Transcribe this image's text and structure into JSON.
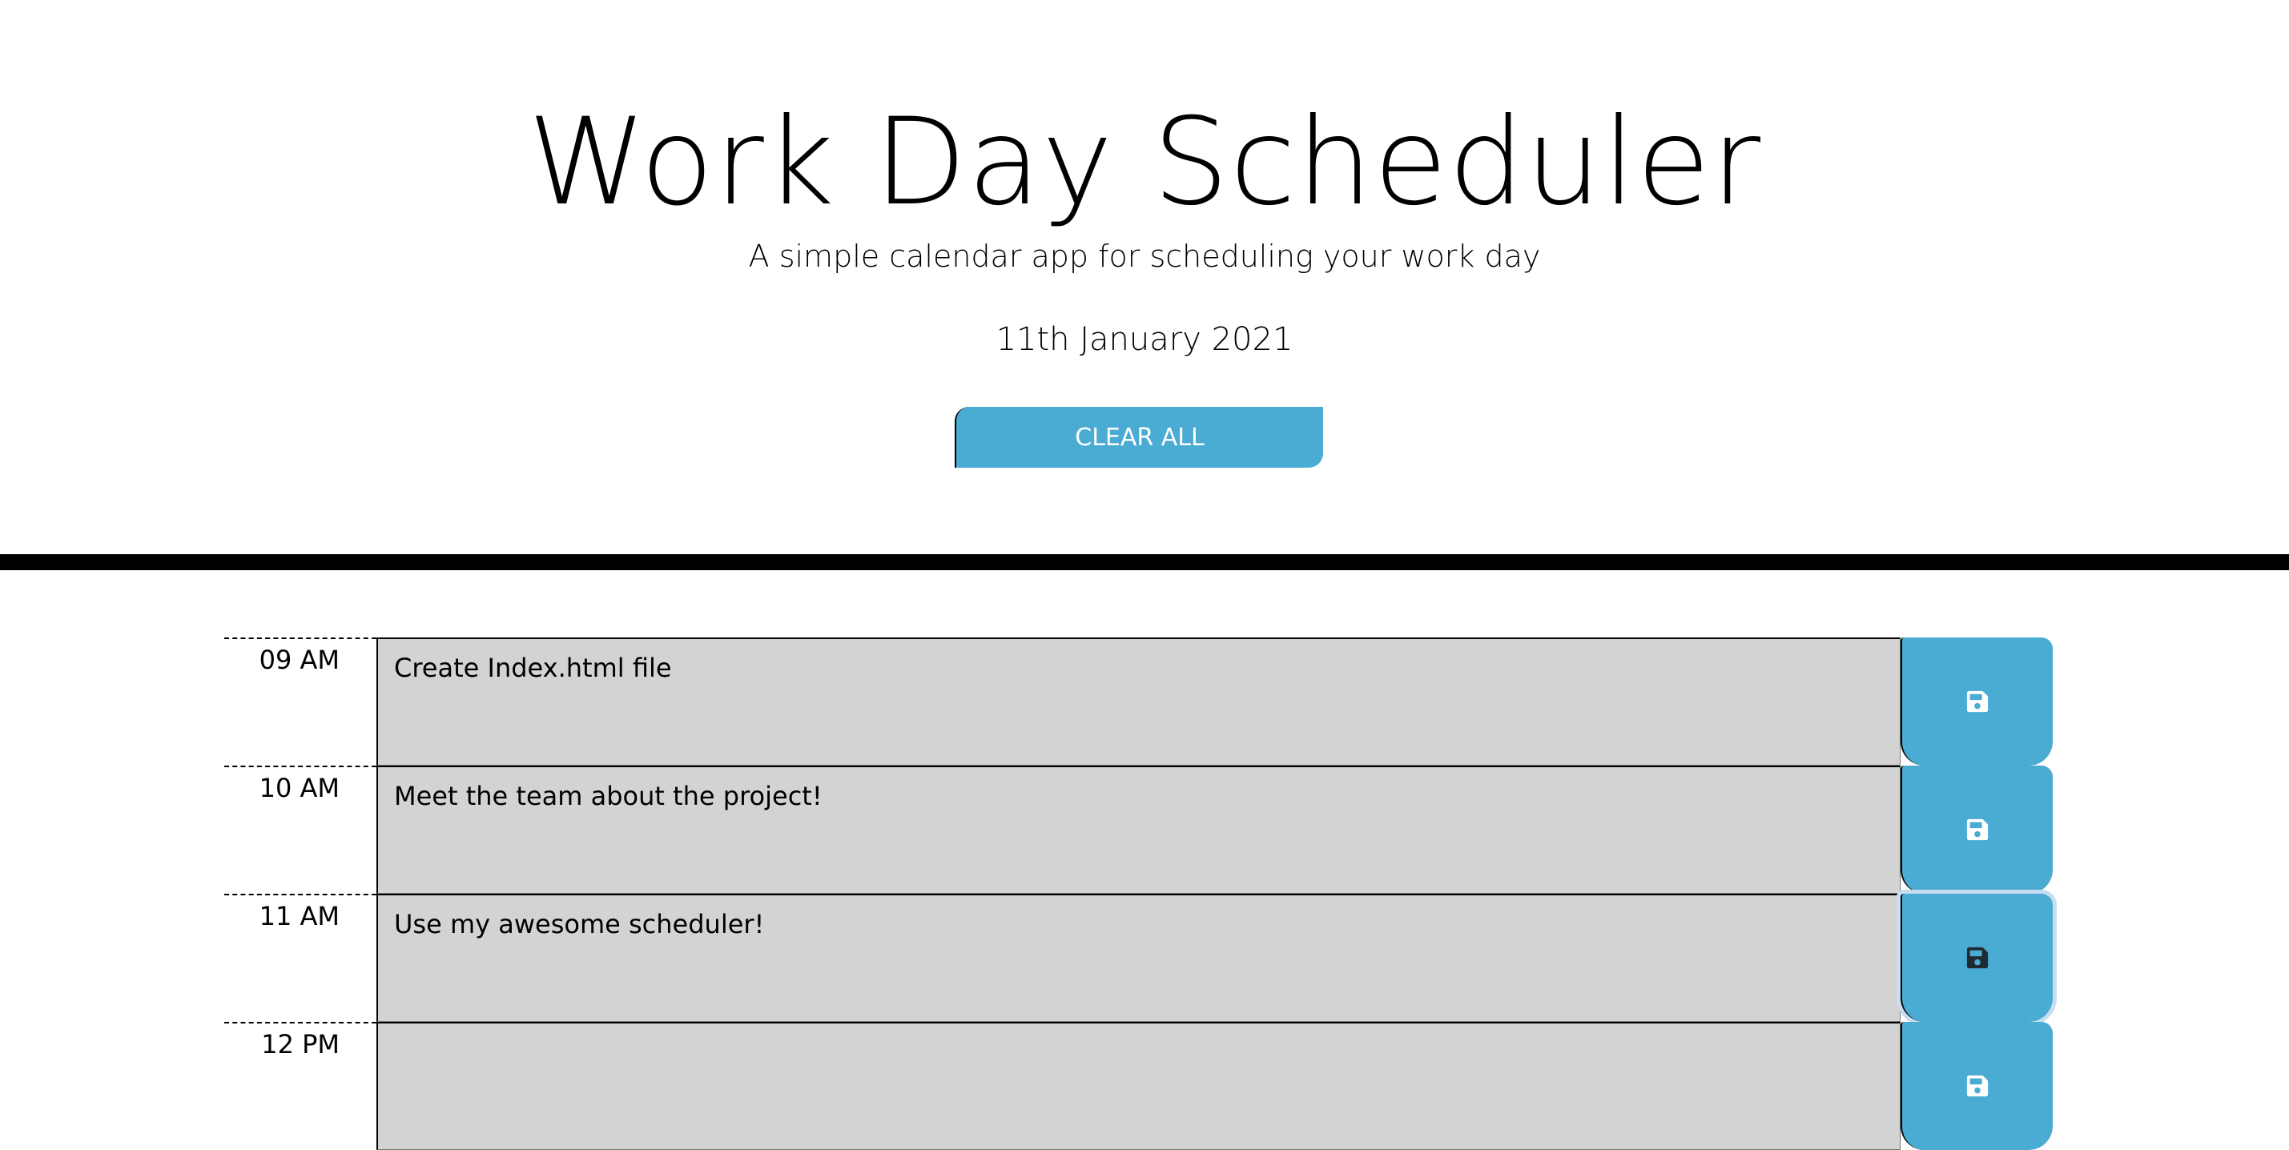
{
  "header": {
    "title": "Work Day Scheduler",
    "subtitle": "A simple calendar app for scheduling your work day",
    "current_day": "11th January 2021",
    "clear_label": "CLEAR ALL"
  },
  "colors": {
    "accent": "#4aabd3",
    "past_block": "#d3d3d3",
    "divider": "#000000"
  },
  "icons": {
    "save": "floppy-disk-icon"
  },
  "timeblocks": [
    {
      "hour": "09 AM",
      "text": "Create Index.html file"
    },
    {
      "hour": "10 AM",
      "text": "Meet the team about the project!"
    },
    {
      "hour": "11 AM",
      "text": "Use my awesome scheduler!"
    },
    {
      "hour": "12 PM",
      "text": ""
    }
  ]
}
